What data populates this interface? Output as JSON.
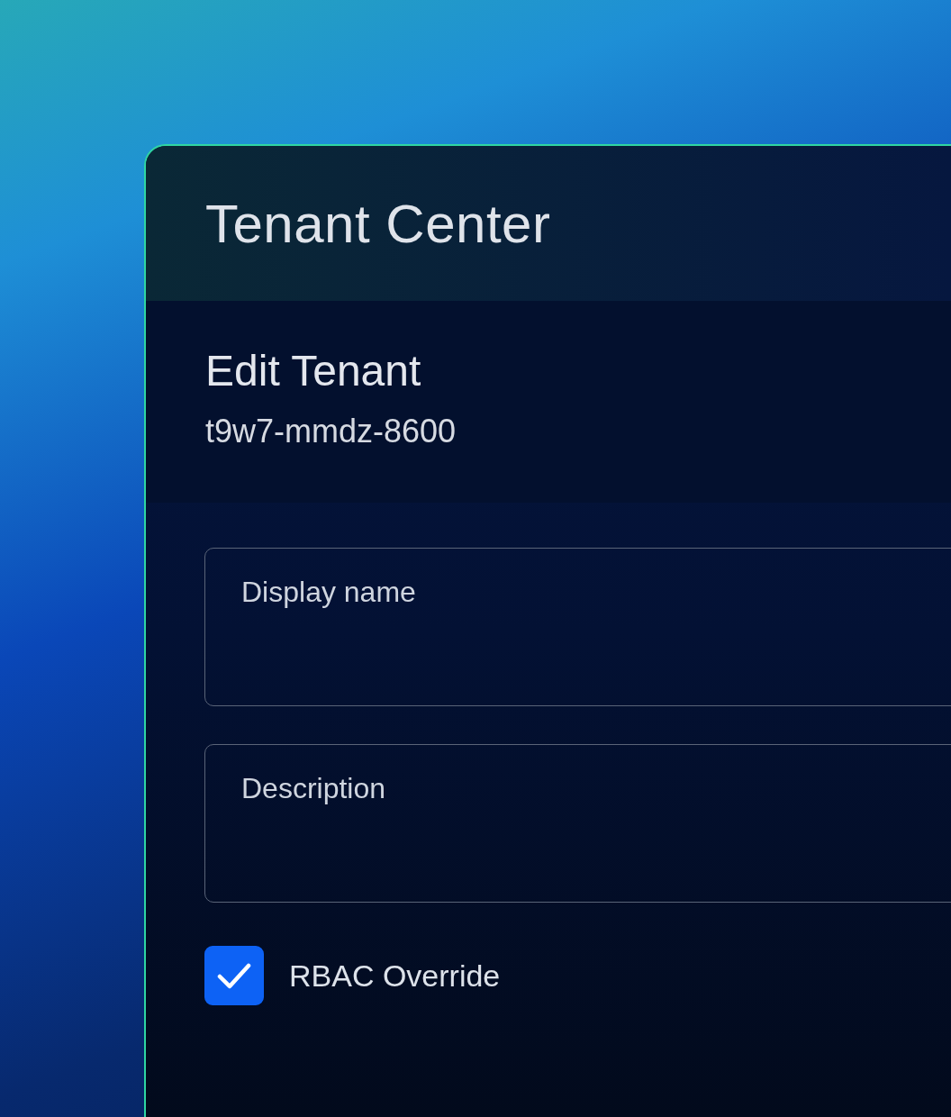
{
  "window": {
    "title": "Tenant Center"
  },
  "section": {
    "title": "Edit Tenant",
    "subtitle": "t9w7-mmdz-8600"
  },
  "fields": [
    {
      "placeholder": "Display name"
    },
    {
      "placeholder": "Description"
    }
  ],
  "checkbox": {
    "label": "RBAC Override",
    "checked": true
  }
}
